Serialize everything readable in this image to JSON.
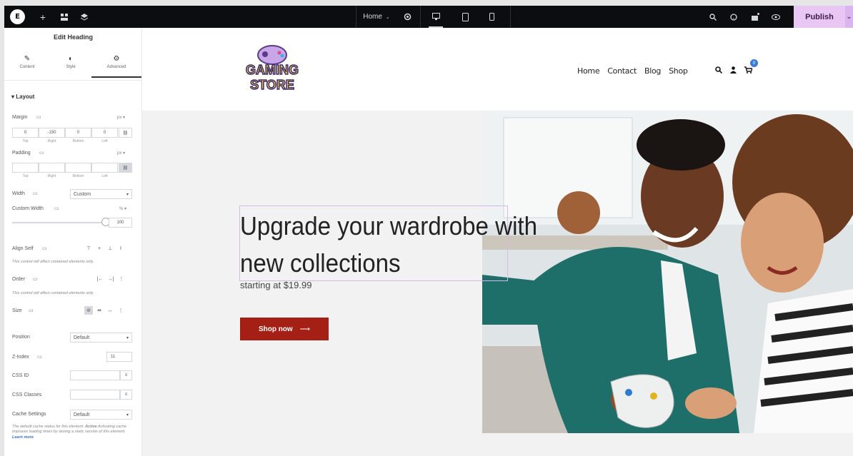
{
  "topbar": {
    "logo_glyph": "E",
    "page_selector": "Home",
    "publish_label": "Publish"
  },
  "panel": {
    "title": "Edit Heading",
    "tabs": [
      {
        "label": "Content",
        "icon": "pencil-icon"
      },
      {
        "label": "Style",
        "icon": "contrast-icon"
      },
      {
        "label": "Advanced",
        "icon": "gear-icon"
      }
    ],
    "active_tab": "Advanced",
    "section": "Layout",
    "margin": {
      "label": "Margin",
      "unit": "px",
      "values": [
        "0",
        "-150",
        "0",
        "0"
      ],
      "sides": [
        "Top",
        "Right",
        "Bottom",
        "Left"
      ]
    },
    "padding": {
      "label": "Padding",
      "unit": "px",
      "values": [
        "",
        "",
        "",
        ""
      ],
      "sides": [
        "Top",
        "Right",
        "Bottom",
        "Left"
      ]
    },
    "width": {
      "label": "Width",
      "value": "Custom"
    },
    "custom_width": {
      "label": "Custom Width",
      "value": "100",
      "unit": "%"
    },
    "align_self": {
      "label": "Align Self",
      "note": "This control will affect contained elements only."
    },
    "order": {
      "label": "Order",
      "note": "This control will affect contained elements only."
    },
    "size": {
      "label": "Size"
    },
    "position": {
      "label": "Position",
      "value": "Default"
    },
    "zindex": {
      "label": "Z-Index",
      "value": "11"
    },
    "css_id": {
      "label": "CSS ID",
      "value": ""
    },
    "css_classes": {
      "label": "CSS Classes",
      "value": ""
    },
    "cache": {
      "label": "Cache Settings",
      "value": "Default",
      "note_pre": "The default cache status for this element:",
      "note_bold": "Active",
      "note_post": "Activating cache improves loading times by storing a static version of this element.",
      "note_link": "Learn more"
    }
  },
  "site": {
    "logo_line1": "GAMING",
    "logo_line2": "STORE",
    "nav": [
      "Home",
      "Contact",
      "Blog",
      "Shop"
    ],
    "cart_count": "0",
    "headline": "Upgrade your wardrobe with new collections",
    "subline": "starting at $19.99",
    "cta_label": "Shop now",
    "cta_arrow": "⟶"
  }
}
